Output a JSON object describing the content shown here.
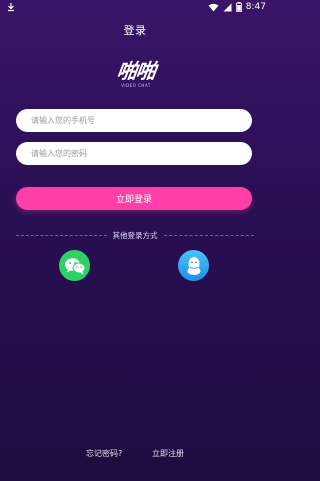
{
  "status_bar": {
    "time": "8:47",
    "icons": [
      "download-icon",
      "wifi-icon",
      "signal-icon",
      "battery-icon"
    ]
  },
  "header": {
    "title": "登录"
  },
  "logo": {
    "main": "啪啪",
    "sub": "VIDEO CHAT"
  },
  "form": {
    "phone_placeholder": "请输入您的手机号",
    "password_placeholder": "请输入您的密码",
    "login_label": "立即登录"
  },
  "social": {
    "divider_text": "其他登录方式",
    "providers": [
      {
        "name": "wechat",
        "icon": "wechat-icon",
        "color": "#2fd166"
      },
      {
        "name": "qq",
        "icon": "qq-icon",
        "color": "#1e8fe6"
      }
    ]
  },
  "footer": {
    "forgot_label": "忘记密码?",
    "register_label": "立即注册"
  },
  "colors": {
    "accent": "#ff3fa8",
    "background": "#2a0f55"
  }
}
